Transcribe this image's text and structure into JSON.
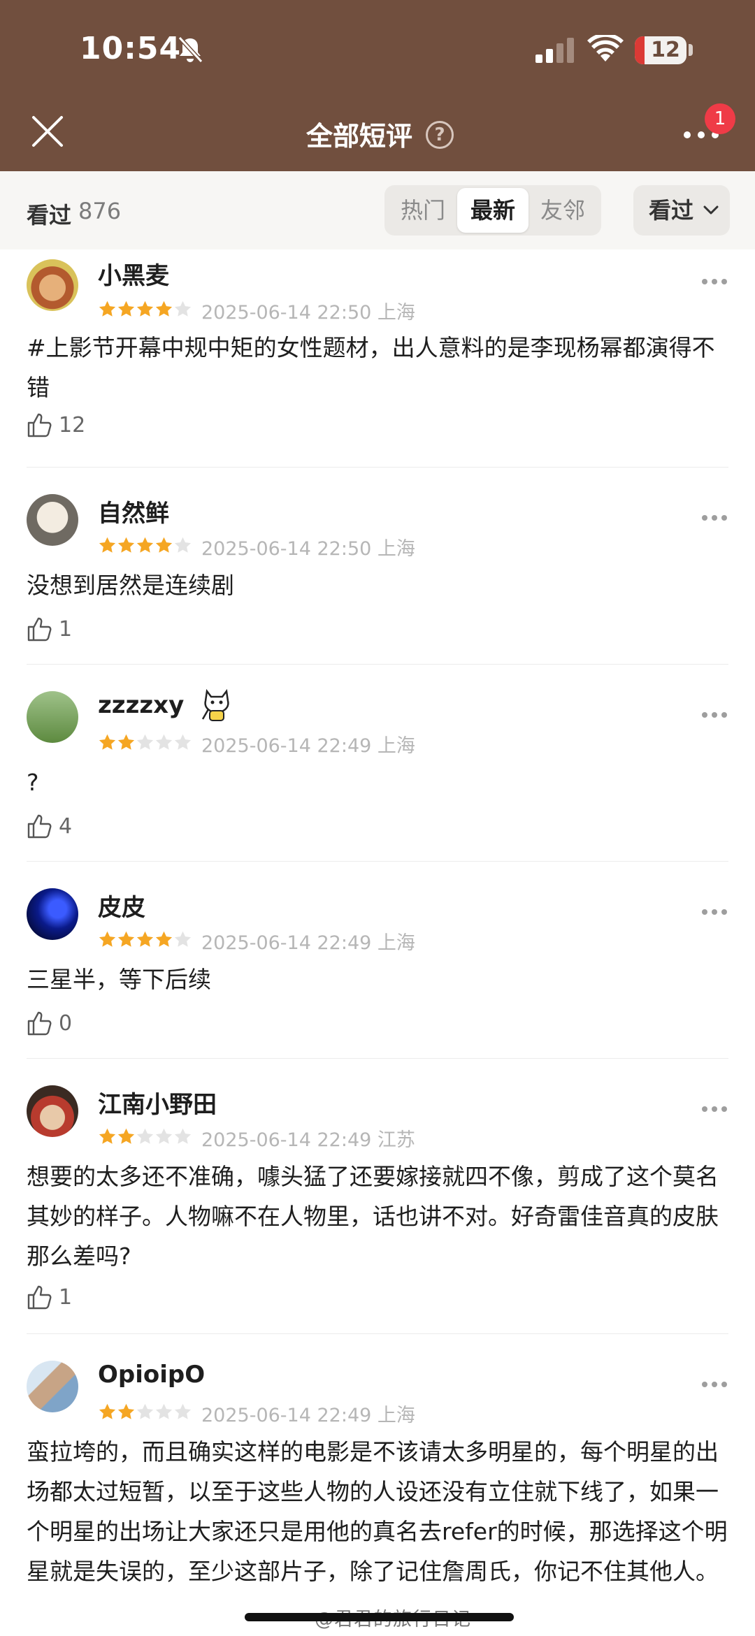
{
  "status_bar": {
    "time": "10:54",
    "battery": "12"
  },
  "nav": {
    "close_label": "×",
    "title": "全部短评",
    "help_label": "?",
    "badge": "1"
  },
  "filter": {
    "count_label": "看过",
    "count": "876",
    "tabs": [
      "热门",
      "最新",
      "友邻"
    ],
    "active_tab": "最新",
    "dropdown": "看过"
  },
  "reviews": [
    {
      "name": "小黑麦",
      "rating": 4,
      "date": "2025-06-14 22:50",
      "location": "上海",
      "text": "#上影节开幕中规中矩的女性题材，出人意料的是李现杨幂都演得不错",
      "likes": "12"
    },
    {
      "name": "自然鲜",
      "rating": 4,
      "date": "2025-06-14 22:50",
      "location": "上海",
      "text": "没想到居然是连续剧",
      "likes": "1"
    },
    {
      "name": "zzzzxy",
      "rating": 2,
      "date": "2025-06-14 22:49",
      "location": "上海",
      "text": "?",
      "likes": "4"
    },
    {
      "name": "皮皮",
      "rating": 4,
      "date": "2025-06-14 22:49",
      "location": "上海",
      "text": "三星半，等下后续",
      "likes": "0"
    },
    {
      "name": "江南小野田",
      "rating": 2,
      "date": "2025-06-14 22:49",
      "location": "江苏",
      "text": "想要的太多还不准确，噱头猛了还要嫁接就四不像，剪成了这个莫名其妙的样子。人物嘛不在人物里，话也讲不对。好奇雷佳音真的皮肤那么差吗?",
      "likes": "1"
    },
    {
      "name": "OpioipO",
      "rating": 2,
      "date": "2025-06-14 22:49",
      "location": "上海",
      "text": "蛮拉垮的，而且确实这样的电影是不该请太多明星的，每个明星的出场都太过短暂，以至于这些人物的人设还没有立住就下线了，如果一个明星的出场让大家还只是用他的真名去refer的时候，那选择这个明星就是失误的，至少这部片子，除了记住詹周氏，你记不住其他人。",
      "likes": ""
    }
  ],
  "watermark": "@君君的旅行日记",
  "colors": {
    "header": "#714f3e",
    "star": "#f5a623",
    "star_empty": "#e3e3e3",
    "badge": "#ef3b47"
  }
}
